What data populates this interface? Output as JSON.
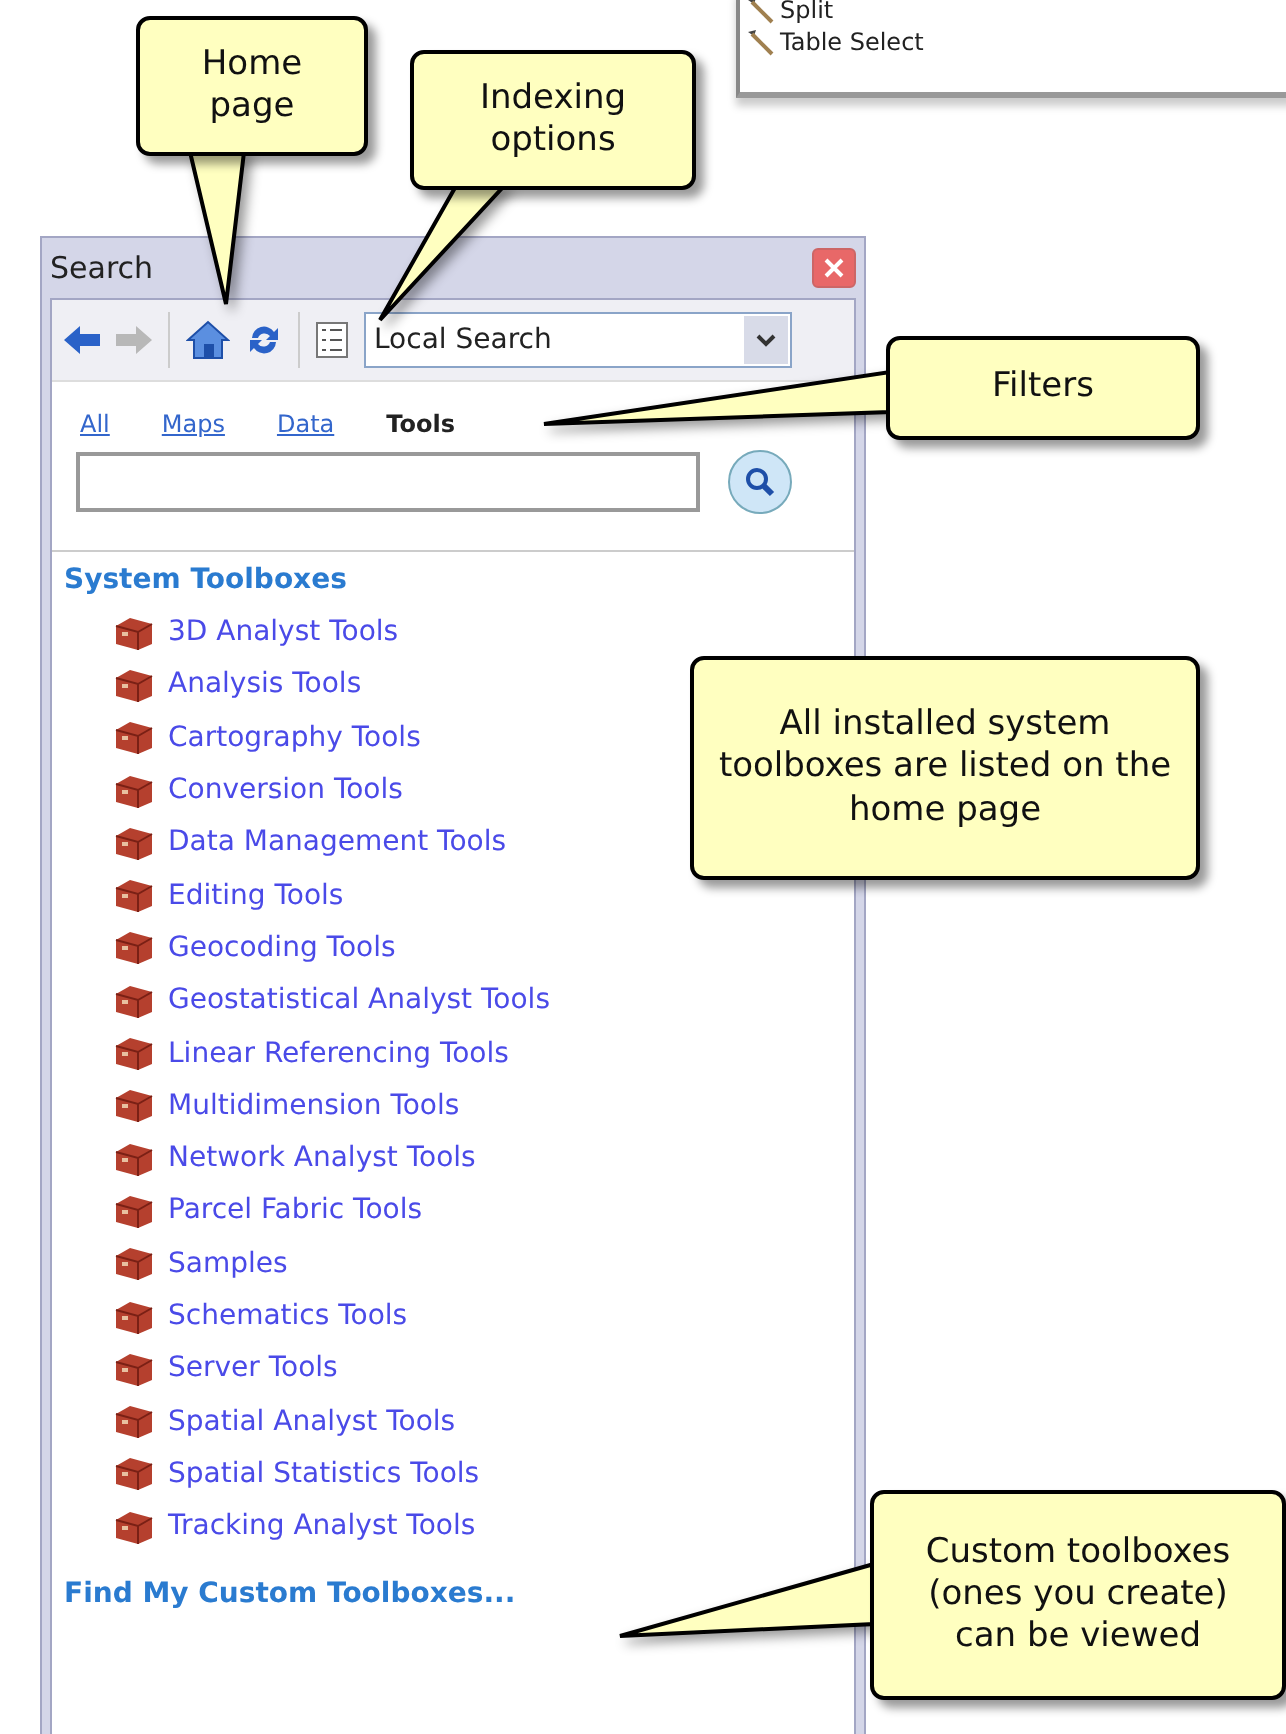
{
  "background_fragment": {
    "items": [
      "Split",
      "Table Select"
    ]
  },
  "callouts": [
    {
      "text": "Home page"
    },
    {
      "text": "Indexing options"
    },
    {
      "text": "Filters"
    },
    {
      "text": "All installed system toolboxes are listed on the home page"
    },
    {
      "text": "Custom toolboxes (ones you create) can be viewed"
    }
  ],
  "panel": {
    "title": "Search",
    "toolbar": {
      "back_enabled": true,
      "forward_enabled": false,
      "scope": "Local Search"
    },
    "filters": [
      {
        "label": "All",
        "selected": false
      },
      {
        "label": "Maps",
        "selected": false
      },
      {
        "label": "Data",
        "selected": false
      },
      {
        "label": "Tools",
        "selected": true
      }
    ],
    "section_title": "System Toolboxes",
    "toolboxes": [
      "3D Analyst Tools",
      "Analysis Tools",
      "Cartography Tools",
      "Conversion Tools",
      "Data Management Tools",
      "Editing Tools",
      "Geocoding Tools",
      "Geostatistical Analyst Tools",
      "Linear Referencing Tools",
      "Multidimension Tools",
      "Network Analyst Tools",
      "Parcel Fabric Tools",
      "Samples",
      "Schematics Tools",
      "Server Tools",
      "Spatial Analyst Tools",
      "Spatial Statistics Tools",
      "Tracking Analyst Tools"
    ],
    "footer_link": "Find My Custom Toolboxes..."
  }
}
